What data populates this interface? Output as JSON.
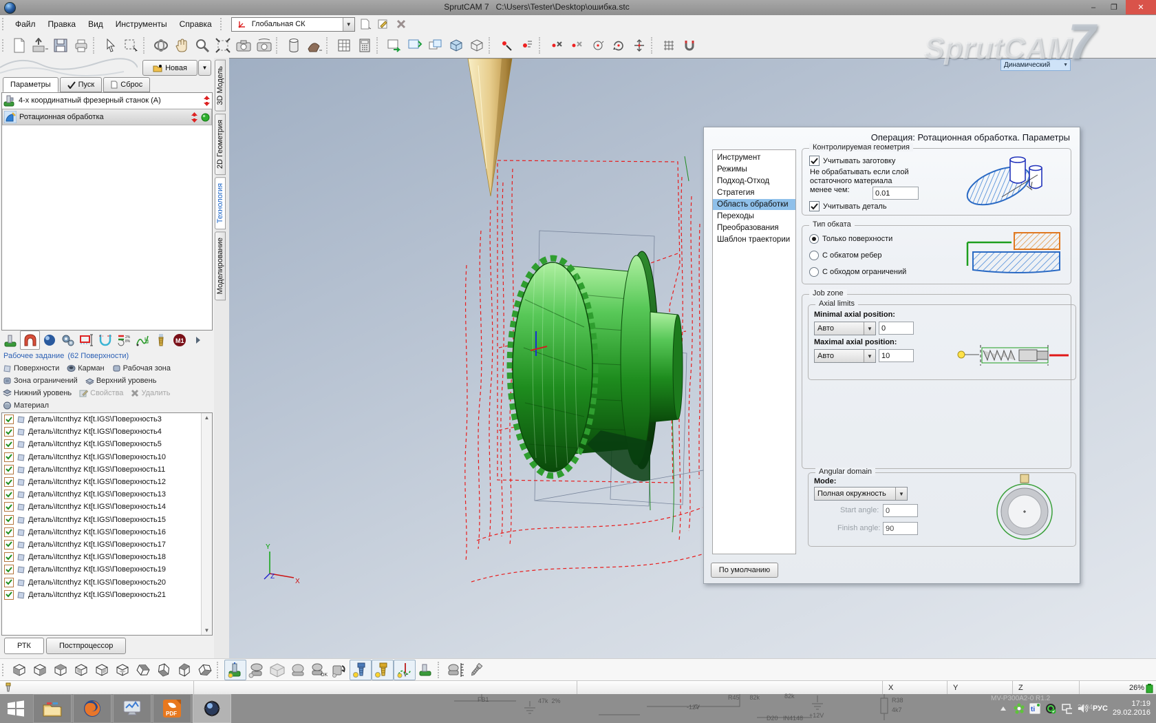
{
  "window": {
    "title": "SprutCAM 7   C:\\Users\\Tester\\Desktop\\ошибка.stc",
    "minimize": "–",
    "maximize": "❐",
    "close": "✕",
    "watermark": "SprutCAM",
    "watermark_number": "7"
  },
  "menu": {
    "items": [
      "Файл",
      "Правка",
      "Вид",
      "Инструменты",
      "Справка"
    ],
    "cs_combo": "Глобальная СК"
  },
  "left_panel": {
    "new_button": "Новая",
    "tabs": [
      "Параметры",
      "Пуск",
      "Сброс"
    ],
    "tree": {
      "machine": "4-х координатный фрезерный станок (А)",
      "operation": "Ротационная обработка"
    },
    "job_header": "Рабочее задание",
    "job_count": "(62 Поверхности)",
    "links": [
      "Поверхности",
      "Карман",
      "Рабочая зона",
      "Зона ограничений",
      "Верхний уровень",
      "Нижний уровень",
      "Свойства",
      "Удалить",
      "Материал"
    ],
    "surfaces": [
      "Деталь\\Itcnthyz Kt[t.IGS\\Поверхность3",
      "Деталь\\Itcnthyz Kt[t.IGS\\Поверхность4",
      "Деталь\\Itcnthyz Kt[t.IGS\\Поверхность5",
      "Деталь\\Itcnthyz Kt[t.IGS\\Поверхность10",
      "Деталь\\Itcnthyz Kt[t.IGS\\Поверхность11",
      "Деталь\\Itcnthyz Kt[t.IGS\\Поверхность12",
      "Деталь\\Itcnthyz Kt[t.IGS\\Поверхность13",
      "Деталь\\Itcnthyz Kt[t.IGS\\Поверхность14",
      "Деталь\\Itcnthyz Kt[t.IGS\\Поверхность15",
      "Деталь\\Itcnthyz Kt[t.IGS\\Поверхность16",
      "Деталь\\Itcnthyz Kt[t.IGS\\Поверхность17",
      "Деталь\\Itcnthyz Kt[t.IGS\\Поверхность18",
      "Деталь\\Itcnthyz Kt[t.IGS\\Поверхность19",
      "Деталь\\Itcnthyz Kt[t.IGS\\Поверхность20",
      "Деталь\\Itcnthyz Kt[t.IGS\\Поверхность21"
    ],
    "bottom_tabs": [
      "РТК",
      "Постпроцессор"
    ]
  },
  "side_tabs": [
    "3D Модель",
    "2D Геометрия",
    "Технология",
    "Моделирование"
  ],
  "viewport": {
    "view_mode": "Динамический",
    "axis": {
      "x": "X",
      "y": "Y",
      "z": "Z"
    }
  },
  "params": {
    "title": "Операция: Ротационная обработка. Параметры",
    "nav": [
      "Инструмент",
      "Режимы",
      "Подход-Отход",
      "Стратегия",
      "Область обработки",
      "Переходы",
      "Преобразования",
      "Шаблон траектории"
    ],
    "geometry": {
      "title": "Контролируемая геометрия",
      "cb_workpiece": "Учитывать заготовку",
      "note1": "Не обрабатывать если слой",
      "note2": "остаточного материала",
      "note3": "менее чем:",
      "value": "0.01",
      "cb_part": "Учитывать деталь"
    },
    "rolling": {
      "title": "Тип обката",
      "opt1": "Только поверхности",
      "opt2": "С обкатом ребер",
      "opt3": "С обходом ограничений"
    },
    "jobzone": {
      "title": "Job zone",
      "axial_title": "Axial limits",
      "min_label": "Minimal axial position:",
      "min_mode": "Авто",
      "min_value": "0",
      "max_label": "Maximal axial position:",
      "max_mode": "Авто",
      "max_value": "10",
      "angular_title": "Angular domain",
      "mode_label": "Mode:",
      "mode_value": "Полная окружность",
      "start_label": "Start angle:",
      "start_value": "0",
      "finish_label": "Finish angle:",
      "finish_value": "90"
    },
    "default_button": "По умолчанию"
  },
  "statusbar": {
    "x": "X",
    "y": "Y",
    "z": "Z",
    "progress": "26%"
  },
  "taskbar": {
    "lang": "РУС",
    "time": "17:19",
    "date": "29.02.2016",
    "wall": {
      "fb1": "FB1",
      "r47k": "47k  2%",
      "r45": "R45      82k",
      "v12n": "-12V",
      "d20": "D20   IN4148",
      "v12p": "+12V",
      "r38": "R38",
      "r4k7": "4k7",
      "r82k": "82k",
      "mv": "MV-P300A2-0 R1.2",
      "y2004": "2004"
    }
  }
}
